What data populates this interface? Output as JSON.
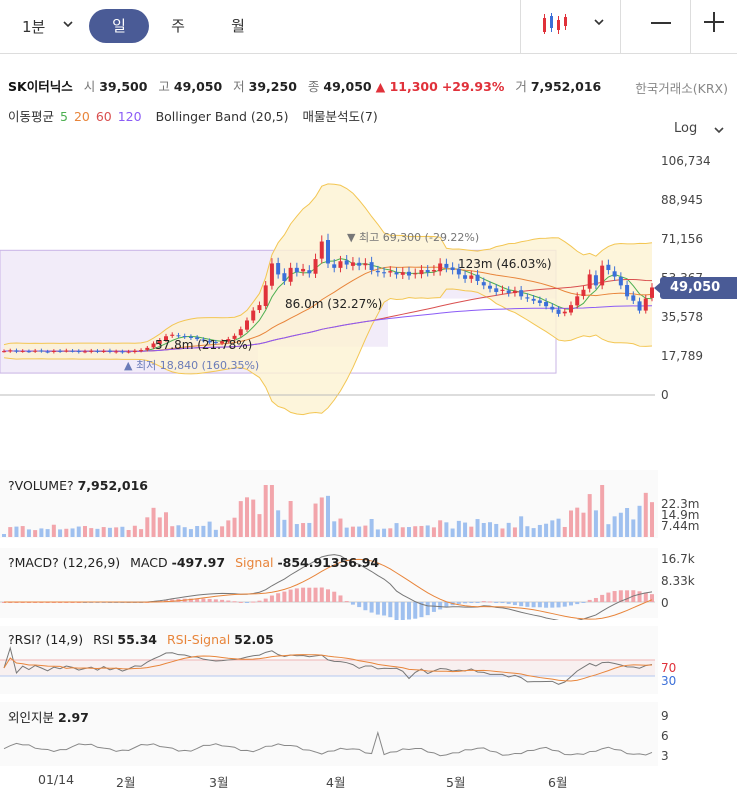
{
  "toolbar": {
    "interval": "1분",
    "tabs": [
      {
        "label": "일",
        "active": true
      },
      {
        "label": "주",
        "active": false
      },
      {
        "label": "월",
        "active": false
      }
    ],
    "chart_type_icon": "candlestick-icon",
    "zoom_out_icon": "minus-icon",
    "zoom_in_icon": "plus-icon"
  },
  "info": {
    "name": "SK이터닉스",
    "open_label": "시",
    "open": "39,500",
    "high_label": "고",
    "high": "49,050",
    "low_label": "저",
    "low": "39,250",
    "close_label": "종",
    "close": "49,050",
    "change": "▲ 11,300",
    "change_pct": "+29.93%",
    "volume_label": "거",
    "volume": "7,952,016",
    "exchange": "한국거래소(KRX)"
  },
  "indicators": {
    "ma_label": "이동평균",
    "ma_periods": [
      "5",
      "20",
      "60",
      "120"
    ],
    "bollinger": "Bollinger Band (20,5)",
    "volume_profile": "매물분석도(7)",
    "scale": "Log"
  },
  "colors": {
    "up": "#e0313a",
    "down": "#3b6fd8",
    "ma5": "#4caf50",
    "ma20": "#e8853b",
    "ma60": "#d94f4f",
    "ma120": "#8b5cf6",
    "band": "#f3c653",
    "accent": "#4a5b96"
  },
  "chart_data": [
    {
      "type": "candlestick",
      "price_axis_ticks": [
        "106,734",
        "88,945",
        "71,156",
        "53,367",
        "35,578",
        "17,789",
        "0"
      ],
      "yticks": [
        106734,
        88945,
        71156,
        53367,
        35578,
        17789,
        0
      ],
      "current_price": "49,050",
      "xticks": [
        "01/14",
        "2월",
        "3월",
        "4월",
        "5월",
        "6월"
      ],
      "annotations": {
        "high": "▼ 최고 69,300 (-29.22%)",
        "low": "▲ 최저 18,840 (160.35%)",
        "vp1": "57.8m (21.78%)",
        "vp2": "86.0m (32.27%)",
        "vp3": "123m (46.03%)"
      },
      "close": [
        20000,
        20300,
        19800,
        20100,
        19900,
        20200,
        20000,
        19700,
        20100,
        19900,
        20300,
        20100,
        19600,
        19900,
        20200,
        19800,
        20100,
        19700,
        19900,
        19500,
        19800,
        20200,
        20500,
        21500,
        23500,
        25000,
        26800,
        27500,
        27000,
        26500,
        26000,
        25500,
        24800,
        24000,
        23800,
        24500,
        25500,
        27000,
        30000,
        34000,
        38500,
        41000,
        50000,
        60000,
        55000,
        52000,
        58000,
        56000,
        57500,
        55500,
        62000,
        70000,
        60000,
        58000,
        61000,
        59500,
        60500,
        59000,
        60000,
        57000,
        56000,
        55500,
        56500,
        55000,
        56000,
        54500,
        55500,
        57000,
        56000,
        57000,
        60000,
        58000,
        57000,
        55000,
        53000,
        54500,
        52000,
        50000,
        48500,
        47000,
        48000,
        46500,
        47500,
        45000,
        44000,
        43000,
        42000,
        40500,
        39000,
        37000,
        38000,
        41000,
        45000,
        48000,
        55000,
        50000,
        59000,
        57000,
        54000,
        50000,
        45000,
        43000,
        38500,
        44000,
        49050
      ]
    },
    {
      "type": "bar",
      "name": "VOLUME",
      "label": "?VOLUME?",
      "value": "7,952,016",
      "yticks": [
        "22.3m",
        "14.9m",
        "7.44m"
      ]
    },
    {
      "type": "line",
      "name": "MACD",
      "label": "?MACD? (12,26,9)",
      "macd_label": "MACD",
      "macd_value": "-497.97",
      "signal_label": "Signal",
      "signal_value": "-854.91356.94",
      "yticks": [
        "16.7k",
        "8.33k",
        "0"
      ]
    },
    {
      "type": "line",
      "name": "RSI",
      "label": "?RSI? (14,9)",
      "rsi_label": "RSI",
      "rsi_value": "55.34",
      "signal_label": "RSI-Signal",
      "signal_value": "52.05",
      "yticks": [
        "70",
        "30"
      ]
    },
    {
      "type": "line",
      "name": "외인지분",
      "label": "외인지분",
      "value": "2.97",
      "yticks": [
        "9",
        "6",
        "3"
      ]
    }
  ]
}
